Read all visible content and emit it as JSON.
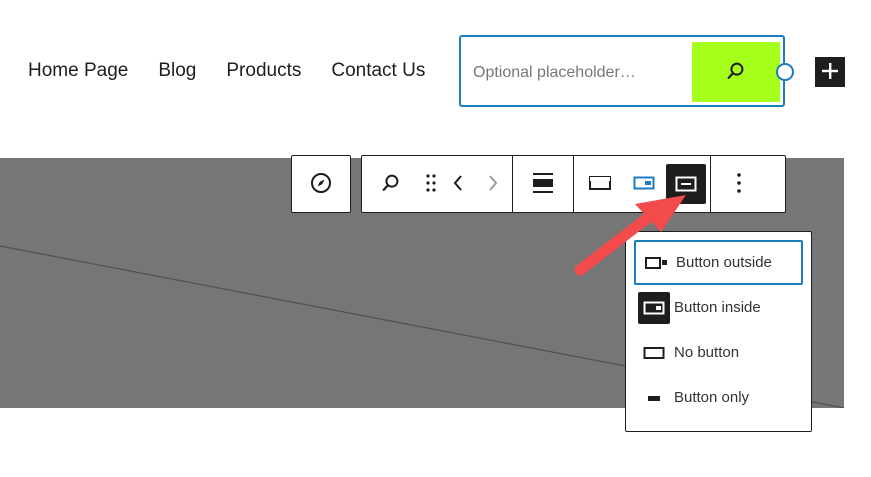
{
  "nav": {
    "items": [
      "Home Page",
      "Blog",
      "Products",
      "Contact Us"
    ]
  },
  "search": {
    "placeholder": "Optional placeholder…",
    "value": ""
  },
  "toolbar": {
    "icons": [
      "compass-icon",
      "search-icon",
      "drag-handle-icon",
      "chevron-left-icon",
      "chevron-right-icon",
      "justify-icon",
      "button-outside-icon",
      "button-inside-icon",
      "no-button-icon",
      "more-options-icon"
    ]
  },
  "dropdown": {
    "items": [
      {
        "label": "Button outside",
        "selected": true
      },
      {
        "label": "Button inside",
        "selected": false
      },
      {
        "label": "No button",
        "selected": false
      },
      {
        "label": "Button only",
        "selected": false
      }
    ]
  },
  "colors": {
    "accent": "#1b7cc0",
    "search_button": "#a6ff1a",
    "band": "#767676",
    "annotation_arrow": "#f34b4b",
    "dark": "#1e1e1e"
  }
}
